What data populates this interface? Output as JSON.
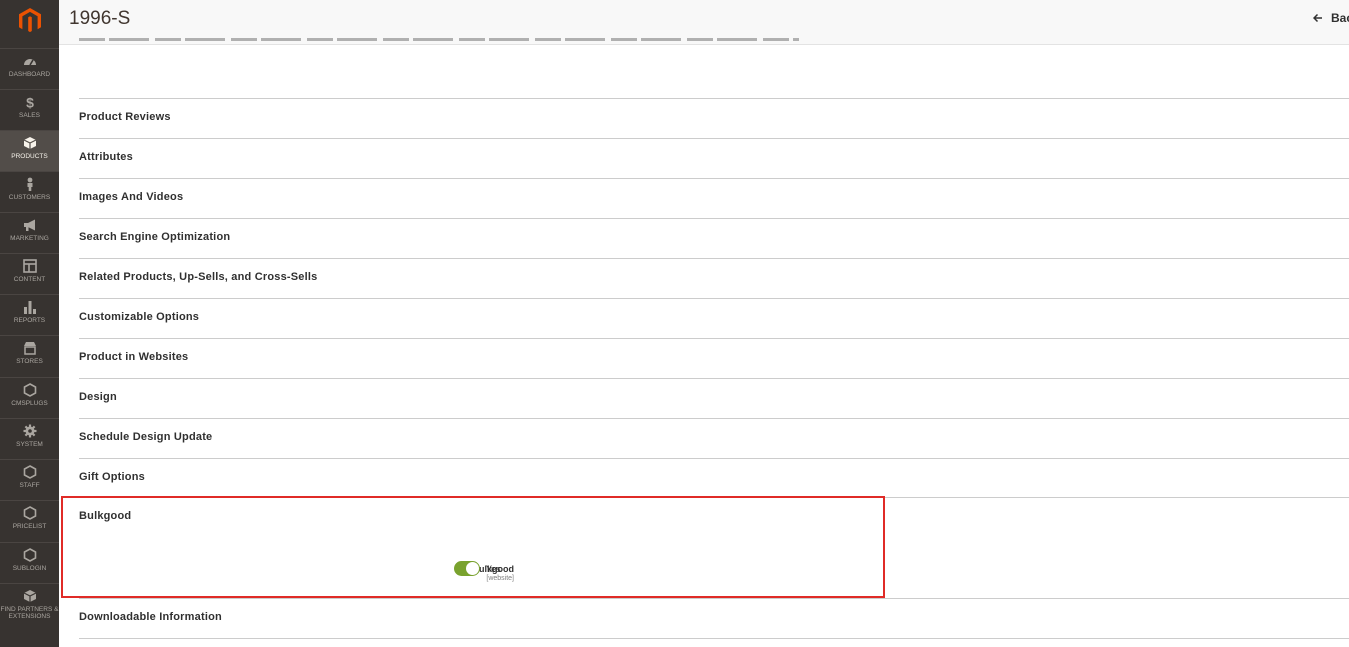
{
  "sidebar": {
    "logo_icon": "magento-logo-icon",
    "items": [
      {
        "label": "DASHBOARD",
        "icon": "speedometer-icon",
        "active": false
      },
      {
        "label": "SALES",
        "icon": "dollar-icon",
        "active": false
      },
      {
        "label": "PRODUCTS",
        "icon": "box-icon",
        "active": true
      },
      {
        "label": "CUSTOMERS",
        "icon": "person-icon",
        "active": false
      },
      {
        "label": "MARKETING",
        "icon": "megaphone-icon",
        "active": false
      },
      {
        "label": "CONTENT",
        "icon": "layout-icon",
        "active": false
      },
      {
        "label": "REPORTS",
        "icon": "bar-chart-icon",
        "active": false
      },
      {
        "label": "STORES",
        "icon": "storefront-icon",
        "active": false
      },
      {
        "label": "CMSPLUGS",
        "icon": "hexagon-icon",
        "active": false
      },
      {
        "label": "SYSTEM",
        "icon": "gear-icon",
        "active": false
      },
      {
        "label": "STAFF",
        "icon": "hexagon-icon",
        "active": false
      },
      {
        "label": "PRICELIST",
        "icon": "hexagon-icon",
        "active": false
      },
      {
        "label": "SUBLOGIN",
        "icon": "hexagon-icon",
        "active": false
      },
      {
        "label": "FIND PARTNERS & EXTENSIONS",
        "icon": "cube-icon",
        "active": false
      }
    ]
  },
  "header": {
    "title": "1996-S",
    "back_label": "Bac"
  },
  "sections": [
    {
      "title": "Product Reviews"
    },
    {
      "title": "Attributes"
    },
    {
      "title": "Images And Videos"
    },
    {
      "title": "Search Engine Optimization"
    },
    {
      "title": "Related Products, Up-Sells, and Cross-Sells"
    },
    {
      "title": "Customizable Options"
    },
    {
      "title": "Product in Websites"
    },
    {
      "title": "Design"
    },
    {
      "title": "Schedule Design Update"
    },
    {
      "title": "Gift Options"
    }
  ],
  "bulkgood": {
    "title": "Bulkgood",
    "field_label": "Bulkgood",
    "field_scope": "[website]",
    "toggle_value": "Yes"
  },
  "downloadable": {
    "title": "Downloadable Information"
  },
  "colors": {
    "sidebar_bg": "#373330",
    "sidebar_active": "#524d49",
    "brand_orange": "#eb5202",
    "toggle_on": "#79a22e",
    "highlight_border": "#e02b27"
  }
}
